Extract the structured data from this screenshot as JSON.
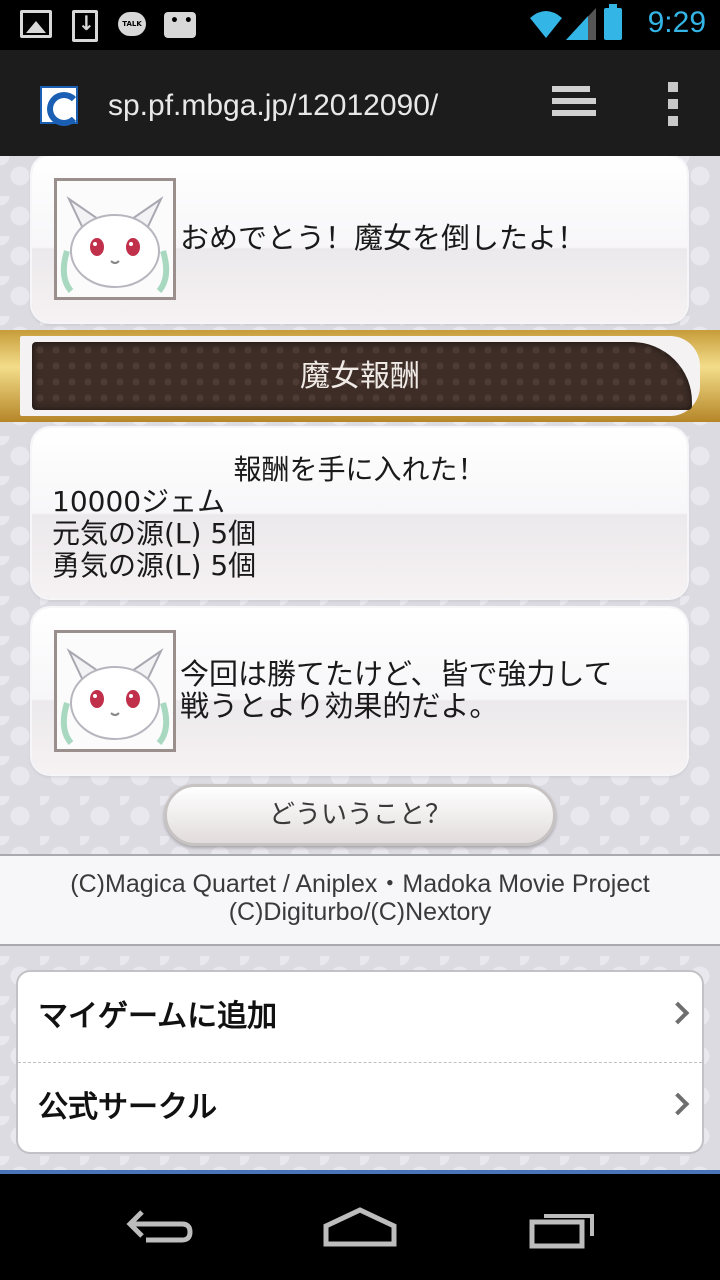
{
  "status_bar": {
    "time": "9:29",
    "icons": [
      "gallery-icon",
      "download-icon",
      "kakaotalk-icon",
      "chat-icon",
      "wifi-icon",
      "signal-icon",
      "battery-icon"
    ],
    "talk_label": "TALK",
    "accent_color": "#33b5e5"
  },
  "browser": {
    "url": "sp.pf.mbga.jp/12012090/",
    "icons": [
      "site-favicon",
      "tabs-icon",
      "overflow-menu-icon"
    ]
  },
  "messages": [
    {
      "text_lines": [
        "おめでとう！魔女を倒したよ！"
      ]
    },
    {
      "text_lines": [
        "今回は勝てたけど、皆で強力して",
        "戦うとより効果的だよ。"
      ]
    }
  ],
  "section": {
    "title": "魔女報酬"
  },
  "reward": {
    "heading": "報酬を手に入れた！",
    "items": [
      "10000ジェム",
      "元気の源(L) 5個",
      "勇気の源(L) 5個"
    ]
  },
  "action_button": {
    "label": "どういうこと？"
  },
  "copyright": {
    "line1": "(C)Magica Quartet / Aniplex・Madoka Movie Project",
    "line2": "(C)Digiturbo/(C)Nextory"
  },
  "links": [
    {
      "label": "マイゲームに追加"
    },
    {
      "label": "公式サークル"
    }
  ],
  "nav_bar": {
    "icons": [
      "back-icon",
      "home-icon",
      "recent-apps-icon"
    ]
  }
}
